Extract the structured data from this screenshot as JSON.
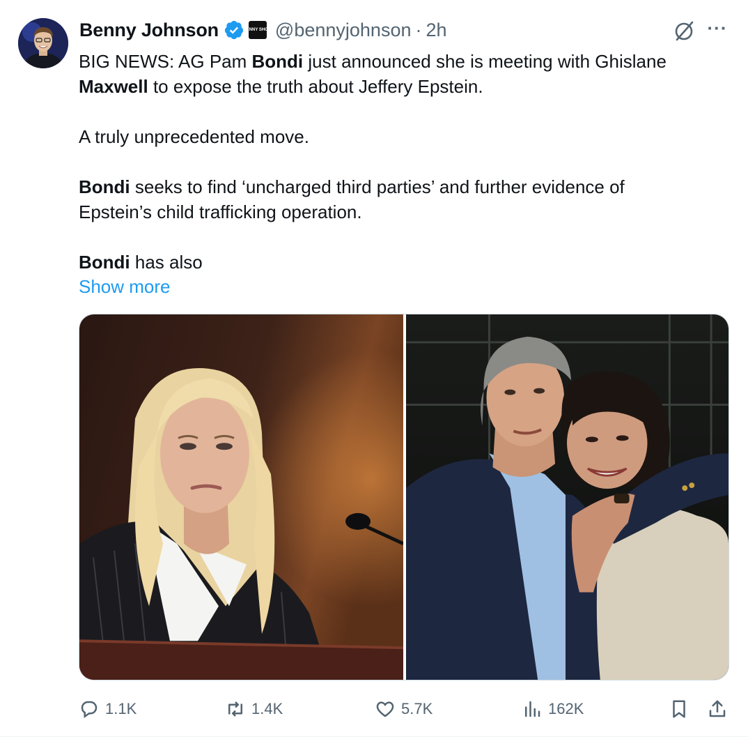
{
  "author": {
    "display_name": "Benny Johnson",
    "handle": "@bennyjohnson",
    "separator": "·",
    "timestamp": "2h",
    "affiliate_badge_text": "BENNY SHOW",
    "verified_color": "#1d9bf0"
  },
  "tweet": {
    "lines": [
      {
        "segments": [
          {
            "t": "BIG NEWS: AG Pam ",
            "b": false
          },
          {
            "t": "Bondi",
            "b": true
          },
          {
            "t": " just announced she is meeting with Ghislane",
            "b": false
          }
        ]
      },
      {
        "segments": [
          {
            "t": "Maxwell",
            "b": true
          },
          {
            "t": " to expose the truth about Jeffery Epstein.",
            "b": false
          }
        ]
      },
      {
        "gap": true
      },
      {
        "segments": [
          {
            "t": "A truly unprecedented move.",
            "b": false
          }
        ]
      },
      {
        "gap": true
      },
      {
        "segments": [
          {
            "t": "Bondi",
            "b": true
          },
          {
            "t": " seeks to find ‘uncharged third parties’ and further evidence of",
            "b": false
          }
        ]
      },
      {
        "segments": [
          {
            "t": "Epstein’s child trafficking operation.",
            "b": false
          }
        ]
      },
      {
        "gap": true
      },
      {
        "segments": [
          {
            "t": "Bondi",
            "b": true
          },
          {
            "t": " has also",
            "b": false
          }
        ]
      }
    ],
    "show_more": "Show more",
    "link_color": "#1d9bf0"
  },
  "media": {
    "left_image": "photo-woman-at-hearing",
    "right_image": "photo-man-and-woman-embracing"
  },
  "actions": {
    "replies": "1.1K",
    "reposts": "1.4K",
    "likes": "5.7K",
    "views": "162K"
  },
  "icons": {
    "more": "more-icon",
    "grok": "grok-icon",
    "reply": "reply-icon",
    "repost": "repost-icon",
    "like": "heart-icon",
    "views": "views-icon",
    "bookmark": "bookmark-icon",
    "share": "share-icon"
  },
  "colors": {
    "text": "#0f1419",
    "secondary": "#536471",
    "accent": "#1d9bf0"
  }
}
